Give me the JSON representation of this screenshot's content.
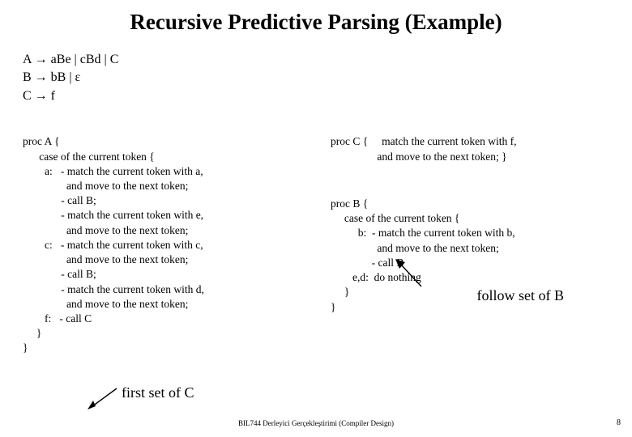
{
  "title": "Recursive Predictive Parsing (Example)",
  "grammar": {
    "line1": "A → aBe | cBd  |  C",
    "line2": "B → bB | ε",
    "line3": "C → f"
  },
  "procA": {
    "l0": "proc A {",
    "l1": "      case of the current token {",
    "l2": "        a:   - match the current token with a,",
    "l3": "                and move to the next token;",
    "l4": "              - call B;",
    "l5": "              - match the current token with e,",
    "l6": "                and move to the next token;",
    "l7": "        c:   - match the current token with c,",
    "l8": "                and move to the next token;",
    "l9": "              - call B;",
    "l10": "              - match the current token with d,",
    "l11": "                and move to the next token;",
    "l12": "        f:   - call C",
    "l13": "     }",
    "l14": "}"
  },
  "procC": {
    "l0": "proc C {     match the current token with f,",
    "l1": "                 and move to the next token; }"
  },
  "procB": {
    "l0": "proc B {",
    "l1": "     case of the current token {",
    "l2": "          b:  - match the current token with b,",
    "l3": "                 and move to the next token;",
    "l4": "               - call B",
    "l5": "        e,d:  do nothing",
    "l6": "     }",
    "l7": "}"
  },
  "annotations": {
    "firstC": "first set of C",
    "followB": "follow set of B"
  },
  "footer": "BIL744 Derleyici Gerçekleştirimi (Compiler Design)",
  "pageNumber": "8"
}
